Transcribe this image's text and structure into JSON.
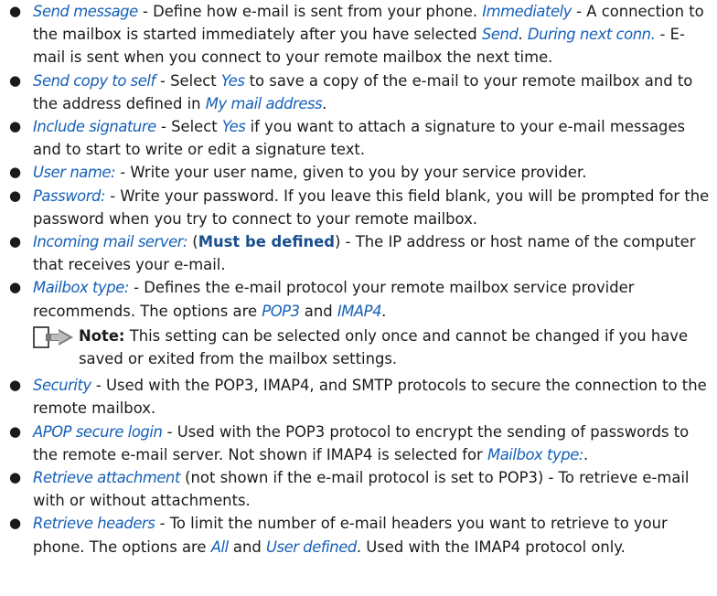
{
  "items": [
    {
      "term": "Send message",
      "t1": " - Define how e-mail is sent from your phone. ",
      "term2": "Immediately",
      "t2": " - A connection to the mailbox is started immediately after you have selected ",
      "term3": "Send",
      "t3": ". ",
      "term4": "During next conn.",
      "t4": " - E-mail is sent when you connect to your remote mailbox the next time."
    },
    {
      "term": "Send copy to self",
      "t1": " - Select ",
      "term2": "Yes",
      "t2": " to save a copy of the e-mail to your remote mailbox and to the address defined in ",
      "term3": "My mail address",
      "t3": "."
    },
    {
      "term": "Include signature",
      "t1": " - Select ",
      "term2": "Yes",
      "t2": " if you want to attach a signature to your e-mail messages and to start to write or edit a signature text."
    },
    {
      "term": "User name:",
      "t1": " - Write your user name, given to you by your service provider."
    },
    {
      "term": "Password:",
      "t1": " - Write your password. If you leave this field blank, you will be prompted for the password when you try to connect to your remote mailbox."
    },
    {
      "term": "Incoming mail server:",
      "t1": " (",
      "bold": "Must be defined",
      "t2": ") - The IP address or host name of the computer that receives your e-mail."
    },
    {
      "term": "Mailbox type:",
      "t1": " - Defines the e-mail protocol your remote mailbox service provider recommends. The options are ",
      "term2": "POP3",
      "t2": " and ",
      "term3": "IMAP4",
      "t3": "."
    },
    {
      "term": "Security",
      "t1": " - Used with the POP3, IMAP4, and SMTP protocols to secure the connection to the remote mailbox."
    },
    {
      "term": "APOP secure login",
      "t1": " - Used with the POP3 protocol to encrypt the sending of passwords to the remote e-mail server. Not shown if IMAP4 is selected for ",
      "term2": "Mailbox type:",
      "t2": "."
    },
    {
      "term": "Retrieve attachment",
      "t1": " (not shown if the e-mail protocol is set to POP3) - To retrieve e-mail with or without attachments."
    },
    {
      "term": "Retrieve headers",
      "t1": " - To limit the number of e-mail headers you want to retrieve to your phone. The options are ",
      "term2": "All",
      "t2": " and ",
      "term3": "User defined",
      "t3": ". Used with the IMAP4 protocol only."
    }
  ],
  "note": {
    "label": "Note:",
    "text": " This setting can be selected only once and cannot be changed if you have saved or exited from the mailbox settings."
  }
}
